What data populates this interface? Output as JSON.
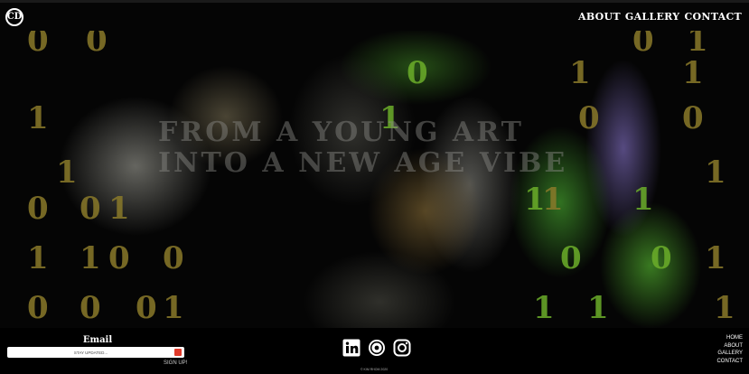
{
  "header": {
    "logo_text": "CD",
    "nav": [
      "About",
      "Gallery",
      "Contact"
    ]
  },
  "hero": {
    "tagline_line1": "From a young art",
    "tagline_line2": "into a new age vibe",
    "binary_digits": [
      {
        "t": "1",
        "c": "olive"
      },
      {
        "t": "0",
        "c": "olive"
      },
      {
        "t": "1",
        "c": "olive"
      },
      {
        "t": "0",
        "c": "olive"
      },
      {
        "t": "1",
        "c": "olive"
      },
      {
        "t": "0",
        "c": "olive"
      },
      {
        "t": "1",
        "c": "olive"
      },
      {
        "t": "0",
        "c": "olive"
      },
      {
        "t": "1",
        "c": "olive"
      },
      {
        "t": "0",
        "c": "olive"
      },
      {
        "t": "0",
        "c": "olive"
      },
      {
        "t": "0",
        "c": "olive"
      },
      {
        "t": "1",
        "c": "olive"
      },
      {
        "t": "0",
        "c": "olive"
      },
      {
        "t": "0",
        "c": "olive"
      },
      {
        "t": "0",
        "c": "olive"
      },
      {
        "t": "1",
        "c": "olive"
      },
      {
        "t": "1",
        "c": "olive"
      },
      {
        "t": "0",
        "c": "olive"
      },
      {
        "t": "1",
        "c": "olive"
      },
      {
        "t": "1",
        "c": "olive"
      },
      {
        "t": "1",
        "c": "olive"
      },
      {
        "t": "1",
        "c": "olive"
      },
      {
        "t": "0",
        "c": "olive"
      },
      {
        "t": "1",
        "c": "olive"
      },
      {
        "t": "1",
        "c": "green"
      },
      {
        "t": "0",
        "c": "green"
      },
      {
        "t": "1",
        "c": "green"
      },
      {
        "t": "0",
        "c": "green"
      },
      {
        "t": "1",
        "c": "green"
      },
      {
        "t": "1",
        "c": "green"
      },
      {
        "t": "0",
        "c": "green"
      },
      {
        "t": "1",
        "c": "green"
      }
    ]
  },
  "footer": {
    "email_title": "Email",
    "email_placeholder": "STAY UPDATED...",
    "signup_label": "SIGN UP!",
    "social_icons": [
      "linkedin-icon",
      "brand-logo-icon",
      "instagram-icon"
    ],
    "copyright": "© KIM RHOM 2020",
    "nav": [
      "Home",
      "About",
      "Gallery",
      "Contact"
    ]
  },
  "colors": {
    "background": "#000000",
    "binary_olive": "#8a7a2a",
    "binary_green": "#6cae2a",
    "submit_red": "#e03a2a"
  }
}
